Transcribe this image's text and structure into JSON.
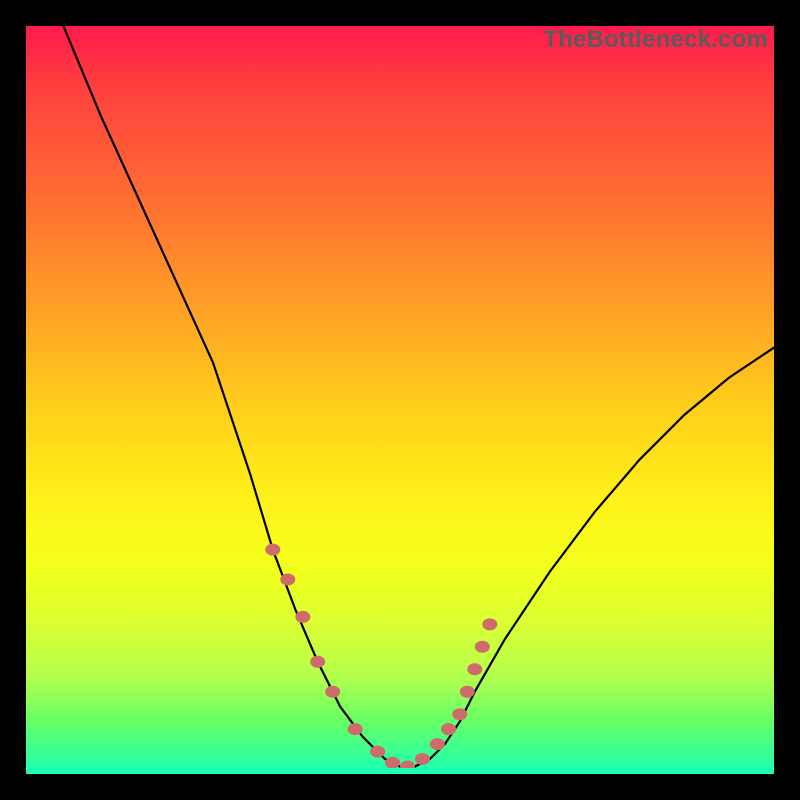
{
  "watermark": "TheBottleneck.com",
  "colors": {
    "frame": "#000000",
    "curve": "#000000",
    "marker": "#cf6b6b",
    "gradient_top": "#ff1a4d",
    "gradient_bottom": "#1affb3"
  },
  "chart_data": {
    "type": "line",
    "title": "",
    "xlabel": "",
    "ylabel": "",
    "xlim": [
      0,
      100
    ],
    "ylim": [
      0,
      100
    ],
    "grid": false,
    "legend": false,
    "series": [
      {
        "name": "bottleneck-curve",
        "x": [
          5,
          10,
          15,
          20,
          25,
          30,
          33,
          36,
          39,
          42,
          45,
          48,
          50,
          52,
          54,
          56,
          58,
          60,
          64,
          70,
          76,
          82,
          88,
          94,
          100
        ],
        "y": [
          100,
          88,
          77,
          66,
          55,
          40,
          30,
          22,
          15,
          9,
          5,
          2,
          1,
          1,
          2,
          4,
          7,
          11,
          18,
          27,
          35,
          42,
          48,
          53,
          57
        ]
      }
    ],
    "markers": {
      "name": "highlighted-points",
      "x": [
        33,
        35,
        37,
        39,
        41,
        44,
        47,
        49,
        51,
        53,
        55,
        56.5,
        58,
        59,
        60,
        61,
        62
      ],
      "y": [
        30,
        26,
        21,
        15,
        11,
        6,
        3,
        1.5,
        1,
        2,
        4,
        6,
        8,
        11,
        14,
        17,
        20
      ]
    }
  }
}
